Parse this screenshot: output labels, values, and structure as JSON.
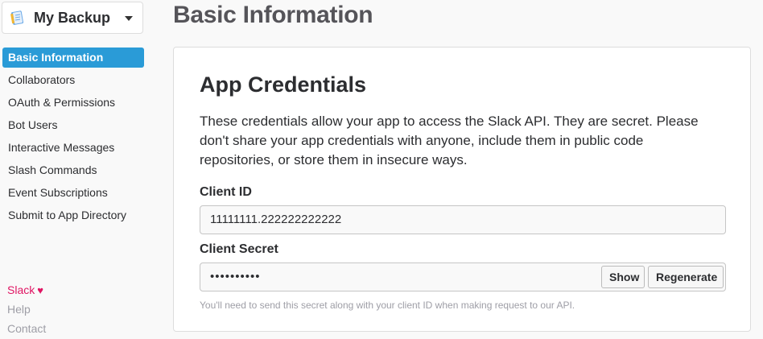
{
  "app_switcher": {
    "name": "My Backup",
    "icon": "app-notebook-icon"
  },
  "sidebar": {
    "items": [
      {
        "label": "Basic Information",
        "active": true
      },
      {
        "label": "Collaborators"
      },
      {
        "label": "OAuth & Permissions"
      },
      {
        "label": "Bot Users"
      },
      {
        "label": "Interactive Messages"
      },
      {
        "label": "Slash Commands"
      },
      {
        "label": "Event Subscriptions"
      },
      {
        "label": "Submit to App Directory"
      }
    ],
    "footer": {
      "slack": "Slack",
      "heart": "♥",
      "help": "Help",
      "contact": "Contact"
    }
  },
  "main": {
    "title": "Basic Information",
    "credentials": {
      "title": "App Credentials",
      "description": "These credentials allow your app to access the Slack API. They are secret. Please don't share your app credentials with anyone, include them in public code repositories, or store them in insecure ways.",
      "client_id_label": "Client ID",
      "client_id_value": "11111111.222222222222",
      "client_secret_label": "Client Secret",
      "client_secret_masked": "••••••••••",
      "show_button": "Show",
      "regenerate_button": "Regenerate",
      "help_text": "You'll need to send this secret along with your client ID when making request to our API."
    }
  },
  "colors": {
    "accent": "#2a9bd7",
    "slack_pink": "#e01563",
    "muted": "#9e9ea6"
  }
}
